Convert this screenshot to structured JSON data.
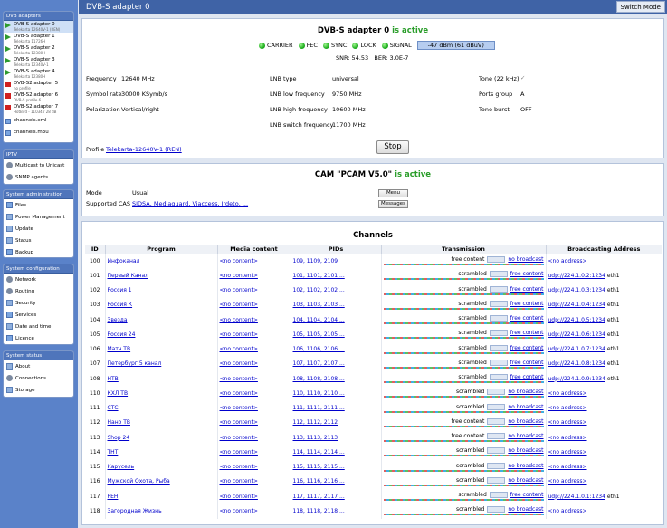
{
  "sidebar": {
    "dvb": {
      "header": "DVB adapters",
      "items": [
        {
          "label": "DVB-S adapter 0",
          "sub": "Telekarta 12640V-1 (REN)",
          "icon": "play-icon",
          "status": "active"
        },
        {
          "label": "DVB-S adapter 1",
          "sub": "Telekarta 11726H",
          "icon": "play-icon",
          "status": "active"
        },
        {
          "label": "DVB-S adapter 2",
          "sub": "Telekarta 12380H",
          "icon": "play-icon",
          "status": "active"
        },
        {
          "label": "DVB-S adapter 3",
          "sub": "Telekarta 12340V-1",
          "icon": "play-icon",
          "status": "active"
        },
        {
          "label": "DVB-S adapter 4",
          "sub": "Telekarta 12380H",
          "icon": "play-icon",
          "status": "active"
        },
        {
          "label": "DVB-S2 adapter 5",
          "sub": "no profile",
          "icon": "stop-icon",
          "status": "stopped"
        },
        {
          "label": "DVB-S2 adapter 6",
          "sub": "DVB-S profile 6",
          "icon": "stop-icon",
          "status": "stopped"
        },
        {
          "label": "DVB-S2 adapter 7",
          "sub": "HotBird - 11034V 28 dB",
          "icon": "stop-icon",
          "status": "stopped"
        },
        {
          "label": "channels.xml",
          "sub": "",
          "icon": "doc-icon",
          "status": ""
        },
        {
          "label": "channels.m3u",
          "sub": "",
          "icon": "doc-icon",
          "status": ""
        }
      ]
    },
    "iptv": {
      "header": "IPTV",
      "items": [
        {
          "label": "Multicast to Unicast"
        },
        {
          "label": "SNMP agents"
        }
      ]
    },
    "sysadmin": {
      "header": "System administration",
      "items": [
        {
          "label": "Files"
        },
        {
          "label": "Power Management"
        },
        {
          "label": "Update"
        },
        {
          "label": "Status"
        },
        {
          "label": "Backup"
        }
      ]
    },
    "sysconf": {
      "header": "System configuration",
      "items": [
        {
          "label": "Network"
        },
        {
          "label": "Routing"
        },
        {
          "label": "Security"
        },
        {
          "label": "Services"
        },
        {
          "label": "Date and time"
        },
        {
          "label": "Licence"
        }
      ]
    },
    "sysstatus": {
      "header": "System status",
      "items": [
        {
          "label": "About"
        },
        {
          "label": "Connections"
        },
        {
          "label": "Storage"
        }
      ]
    }
  },
  "topbar": {
    "title": "DVB-S adapter 0",
    "switch_mode": "Switch Mode"
  },
  "adapter": {
    "title": "DVB-S adapter 0",
    "status": "is active",
    "leds": [
      "CARRIER",
      "FEC",
      "SYNC",
      "LOCK",
      "SIGNAL"
    ],
    "signal": "-47 dBm (61 dBuV)",
    "snr": "SNR: 54.53",
    "ber": "BER: 3.0E-7",
    "frequency_label": "Frequency",
    "frequency": "12640 MHz",
    "symbol_rate_label": "Symbol rate",
    "symbol_rate": "30000 KSymb/s",
    "polarization_label": "Polarization",
    "polarization": "Vertical/right",
    "lnb_type_label": "LNB type",
    "lnb_type": "universal",
    "lnb_low_label": "LNB low frequency",
    "lnb_low": "9750 MHz",
    "lnb_high_label": "LNB high frequency",
    "lnb_high": "10600 MHz",
    "lnb_switch_label": "LNB switch frequency",
    "lnb_switch": "11700 MHz",
    "tone_label": "Tone (22 kHz)",
    "tone_value": "✓",
    "ports_label": "Ports group",
    "ports": "A",
    "burst_label": "Tone burst",
    "burst": "OFF",
    "profile_label": "Profile",
    "profile": "Telekarta-12640V-1 (REN)",
    "stop_label": "Stop"
  },
  "cam": {
    "title": "CAM \"PCAM V5.0\"",
    "status": "is active",
    "mode_label": "Mode",
    "mode": "Usual",
    "cas_label": "Supported CAS",
    "cas": "SIDSA, Mediaguard, Viaccess, Irdeto, ...",
    "menu_label": "Menu",
    "messages_label": "Messages"
  },
  "channels": {
    "title": "Channels",
    "headers": [
      "ID",
      "Program",
      "Media content",
      "PIDs",
      "Transmission",
      "Broadcasting Address"
    ],
    "rows": [
      {
        "id": "100",
        "program": "Инфоканал",
        "media": "<no content>",
        "pids": "109, 1109, 2109",
        "trans": "free content",
        "link": "no broadcast",
        "addr": "<no address>",
        "eth": ""
      },
      {
        "id": "101",
        "program": "Первый Канал",
        "media": "<no content>",
        "pids": "101, 1101, 2101 ...",
        "trans": "scrambled",
        "link": "free content",
        "addr": "udp://224.1.0.2:1234",
        "eth": "eth1"
      },
      {
        "id": "102",
        "program": "Россия 1",
        "media": "<no content>",
        "pids": "102, 1102, 2102 ...",
        "trans": "scrambled",
        "link": "free content",
        "addr": "udp://224.1.0.3:1234",
        "eth": "eth1"
      },
      {
        "id": "103",
        "program": "Россия К",
        "media": "<no content>",
        "pids": "103, 1103, 2103 ...",
        "trans": "scrambled",
        "link": "free content",
        "addr": "udp://224.1.0.4:1234",
        "eth": "eth1"
      },
      {
        "id": "104",
        "program": "Звезда",
        "media": "<no content>",
        "pids": "104, 1104, 2104 ...",
        "trans": "scrambled",
        "link": "free content",
        "addr": "udp://224.1.0.5:1234",
        "eth": "eth1"
      },
      {
        "id": "105",
        "program": "Россия 24",
        "media": "<no content>",
        "pids": "105, 1105, 2105 ...",
        "trans": "scrambled",
        "link": "free content",
        "addr": "udp://224.1.0.6:1234",
        "eth": "eth1"
      },
      {
        "id": "106",
        "program": "Матч ТВ",
        "media": "<no content>",
        "pids": "106, 1106, 2106 ...",
        "trans": "scrambled",
        "link": "free content",
        "addr": "udp://224.1.0.7:1234",
        "eth": "eth1"
      },
      {
        "id": "107",
        "program": "Петербург 5 канал",
        "media": "<no content>",
        "pids": "107, 1107, 2107 ...",
        "trans": "scrambled",
        "link": "free content",
        "addr": "udp://224.1.0.8:1234",
        "eth": "eth1"
      },
      {
        "id": "108",
        "program": "НТВ",
        "media": "<no content>",
        "pids": "108, 1108, 2108 ...",
        "trans": "scrambled",
        "link": "free content",
        "addr": "udp://224.1.0.9:1234",
        "eth": "eth1"
      },
      {
        "id": "110",
        "program": "КХЛ ТВ",
        "media": "<no content>",
        "pids": "110, 1110, 2110 ...",
        "trans": "scrambled",
        "link": "no broadcast",
        "addr": "<no address>",
        "eth": ""
      },
      {
        "id": "111",
        "program": "СТС",
        "media": "<no content>",
        "pids": "111, 1111, 2111 ...",
        "trans": "scrambled",
        "link": "no broadcast",
        "addr": "<no address>",
        "eth": ""
      },
      {
        "id": "112",
        "program": "Нано ТВ",
        "media": "<no content>",
        "pids": "112, 1112, 2112",
        "trans": "free content",
        "link": "no broadcast",
        "addr": "<no address>",
        "eth": ""
      },
      {
        "id": "113",
        "program": "Shop 24",
        "media": "<no content>",
        "pids": "113, 1113, 2113",
        "trans": "free content",
        "link": "no broadcast",
        "addr": "<no address>",
        "eth": ""
      },
      {
        "id": "114",
        "program": "ТНТ",
        "media": "<no content>",
        "pids": "114, 1114, 2114 ...",
        "trans": "scrambled",
        "link": "no broadcast",
        "addr": "<no address>",
        "eth": ""
      },
      {
        "id": "115",
        "program": "Карусель",
        "media": "<no content>",
        "pids": "115, 1115, 2115 ...",
        "trans": "scrambled",
        "link": "no broadcast",
        "addr": "<no address>",
        "eth": ""
      },
      {
        "id": "116",
        "program": "Мужской Охота, Рыба",
        "media": "<no content>",
        "pids": "116, 1116, 2116 ...",
        "trans": "scrambled",
        "link": "no broadcast",
        "addr": "<no address>",
        "eth": ""
      },
      {
        "id": "117",
        "program": "РЕН",
        "media": "<no content>",
        "pids": "117, 1117, 2117 ...",
        "trans": "scrambled",
        "link": "free content",
        "addr": "udp://224.1.0.1:1234",
        "eth": "eth1"
      },
      {
        "id": "118",
        "program": "Загородная Жизнь",
        "media": "<no content>",
        "pids": "118, 1118, 2118 ...",
        "trans": "scrambled",
        "link": "no broadcast",
        "addr": "<no address>",
        "eth": ""
      }
    ]
  }
}
